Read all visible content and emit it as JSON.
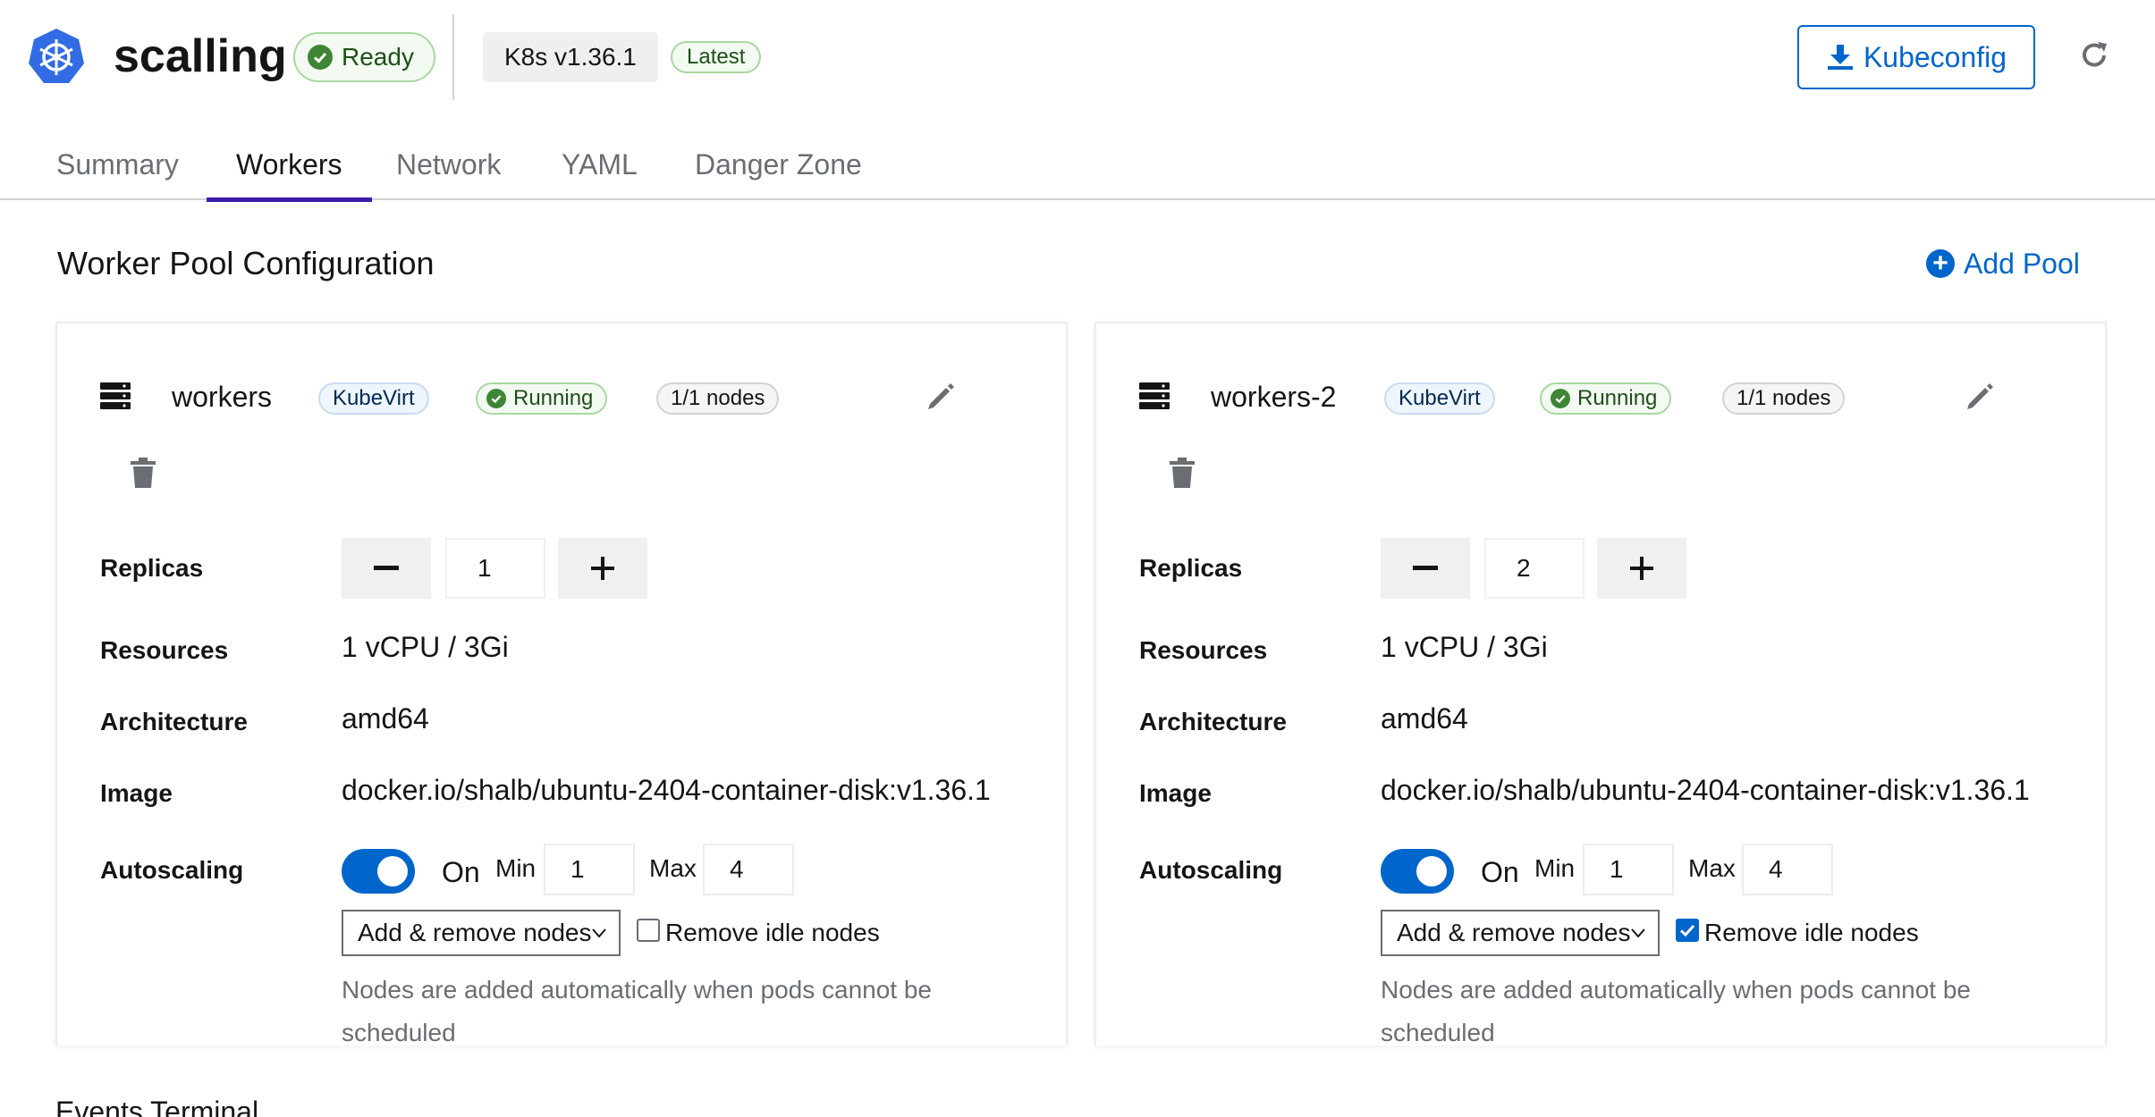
{
  "header": {
    "title": "scalling",
    "status": "Ready",
    "version": "K8s v1.36.1",
    "version_tag": "Latest",
    "kubeconfig_label": "Kubeconfig",
    "logo_icon": "kubernetes-wheel-icon",
    "refresh_icon": "refresh-icon"
  },
  "tabs": [
    {
      "label": "Summary",
      "active": false
    },
    {
      "label": "Workers",
      "active": true
    },
    {
      "label": "Network",
      "active": false
    },
    {
      "label": "YAML",
      "active": false
    },
    {
      "label": "Danger Zone",
      "active": false
    }
  ],
  "section": {
    "title": "Worker Pool Configuration",
    "add_pool_label": "Add Pool"
  },
  "labels": {
    "replicas": "Replicas",
    "resources": "Resources",
    "architecture": "Architecture",
    "image": "Image",
    "autoscaling": "Autoscaling",
    "on": "On",
    "min": "Min",
    "max": "Max",
    "remove_idle": "Remove idle nodes",
    "help": "Nodes are added automatically when pods cannot be scheduled",
    "minus": "−",
    "plus": "+"
  },
  "pools": [
    {
      "name": "workers",
      "provider": "KubeVirt",
      "status": "Running",
      "nodes": "1/1 nodes",
      "replicas": "1",
      "resources": "1 vCPU / 3Gi",
      "architecture": "amd64",
      "image": "docker.io/shalb/ubuntu-2404-container-disk:v1.36.1",
      "autoscaling_on": true,
      "min": "1",
      "max": "4",
      "mode": "Add & remove nodes",
      "remove_idle": false
    },
    {
      "name": "workers-2",
      "provider": "KubeVirt",
      "status": "Running",
      "nodes": "1/1 nodes",
      "replicas": "2",
      "resources": "1 vCPU / 3Gi",
      "architecture": "amd64",
      "image": "docker.io/shalb/ubuntu-2404-container-disk:v1.36.1",
      "autoscaling_on": true,
      "min": "1",
      "max": "4",
      "mode": "Add & remove nodes",
      "remove_idle": true
    }
  ],
  "bottom_tabs": "Events    Terminal",
  "colors": {
    "accent": "#0066cc",
    "active_tab": "#3c1dac",
    "success": "#3e8635"
  }
}
